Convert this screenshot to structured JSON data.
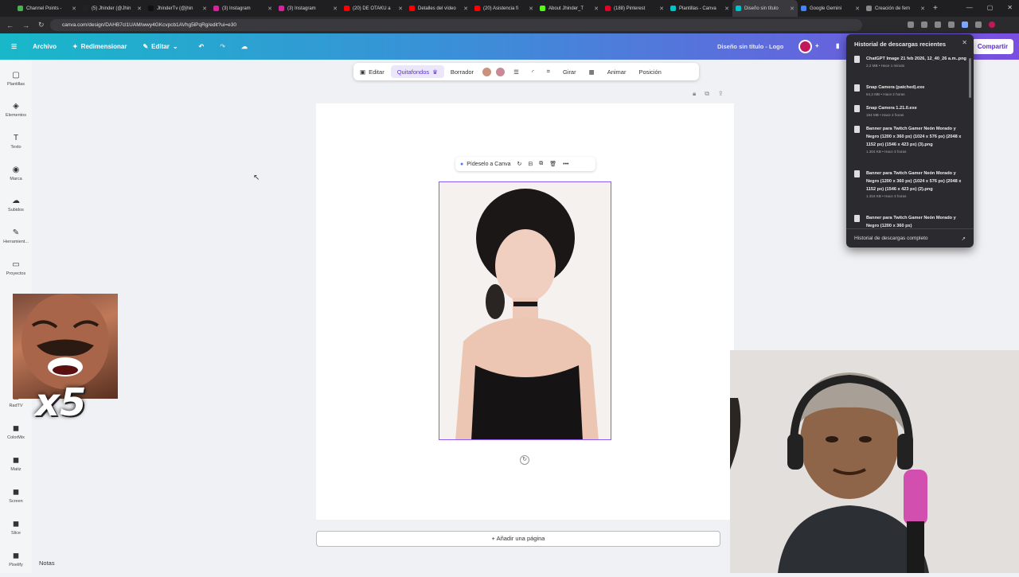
{
  "browser": {
    "tabs": [
      {
        "label": "Channel Points -",
        "color": "#4caf50"
      },
      {
        "label": "(5) Jhinder (@Jhin",
        "color": "#222222"
      },
      {
        "label": "JhinderTv (@jhin",
        "color": "#111111"
      },
      {
        "label": "(3) Instagram",
        "color": "#d6249f"
      },
      {
        "label": "(3) Instagram",
        "color": "#d6249f"
      },
      {
        "label": "(20) DE OTAKU a",
        "color": "#ff0000"
      },
      {
        "label": "Detalles del vídeo",
        "color": "#ff0000"
      },
      {
        "label": "(20) Asistencia fi",
        "color": "#ff0000"
      },
      {
        "label": "About Jhinder_T",
        "color": "#53fc18"
      },
      {
        "label": "(188) Pinterest",
        "color": "#e60023"
      },
      {
        "label": "Plantillas - Canva",
        "color": "#00c4cc"
      },
      {
        "label": "Diseño sin título",
        "color": "#00c4cc",
        "active": true
      },
      {
        "label": "Google Gemini",
        "color": "#4285f4"
      },
      {
        "label": "Creación de fem",
        "color": "#888888"
      }
    ],
    "url": "canva.com/design/DAHB7cl1UAM/wwy4GKcvpcb1AVhg5lPqRg/edit?ui=e30"
  },
  "header": {
    "archivo": "Archivo",
    "redimensionar": "Redimensionar",
    "editar": "Editar",
    "doc_title": "Diseño sin título - Logo",
    "share": "Compartir"
  },
  "sidebar": {
    "items": [
      {
        "label": "Plantillas",
        "icon": "▢"
      },
      {
        "label": "Elementos",
        "icon": "◈"
      },
      {
        "label": "Texto",
        "icon": "T"
      },
      {
        "label": "Marca",
        "icon": "◉"
      },
      {
        "label": "Subidos",
        "icon": "☁"
      },
      {
        "label": "Herramient...",
        "icon": "✎"
      },
      {
        "label": "Proyectos",
        "icon": "▭"
      },
      {
        "label": "RadTV",
        "icon": "◼"
      },
      {
        "label": "ColorMix",
        "icon": "◼"
      },
      {
        "label": "Matiz",
        "icon": "◼"
      },
      {
        "label": "Screen",
        "icon": "◼"
      },
      {
        "label": "Slice",
        "icon": "◼"
      },
      {
        "label": "Pixelify",
        "icon": "◼"
      }
    ]
  },
  "toolbar": {
    "editar": "Editar",
    "quitafondos": "Quitafondos",
    "borrador": "Borrador",
    "girar": "Girar",
    "animar": "Animar",
    "posicion": "Posición",
    "swatch1": "#c9927e",
    "swatch2": "#c98a96"
  },
  "element_bar": {
    "ask": "Pídeselo a Canva"
  },
  "canvas": {
    "add_page": "+ Añadir una página",
    "notes": "Notas"
  },
  "downloads": {
    "title": "Historial de descargas recientes",
    "items": [
      {
        "name": "ChatGPT Image 21 feb 2026, 12_40_26 a.m..png",
        "meta": "2,2 MB • Hace 1 minuto"
      },
      {
        "name": "Snap Camera (patched).exe",
        "meta": "64,2 MB • Hace 2 horas"
      },
      {
        "name": "Snap Camera 1.21.0.exe",
        "meta": "184 MB • Hace 2 horas"
      },
      {
        "name": "Banner para Twitch Gamer Neón Morado y Negro (1200 x 360 px) (1024 x 576 px) (2048 x 1152 px) (1546 x 423 px) (3).png",
        "meta": "1.304 KB • Hace 3 horas"
      },
      {
        "name": "Banner para Twitch Gamer Neón Morado y Negro (1200 x 360 px) (1024 x 576 px) (2048 x 1152 px) (1546 x 423 px) (2).png",
        "meta": "1.316 KB • Hace 3 horas"
      },
      {
        "name": "Banner para Twitch Gamer Neón Morado y Negro (1200 x 360 px)",
        "meta": ""
      }
    ],
    "footer": "Historial de descargas completo"
  },
  "overlay": {
    "multiplier": "x5"
  }
}
